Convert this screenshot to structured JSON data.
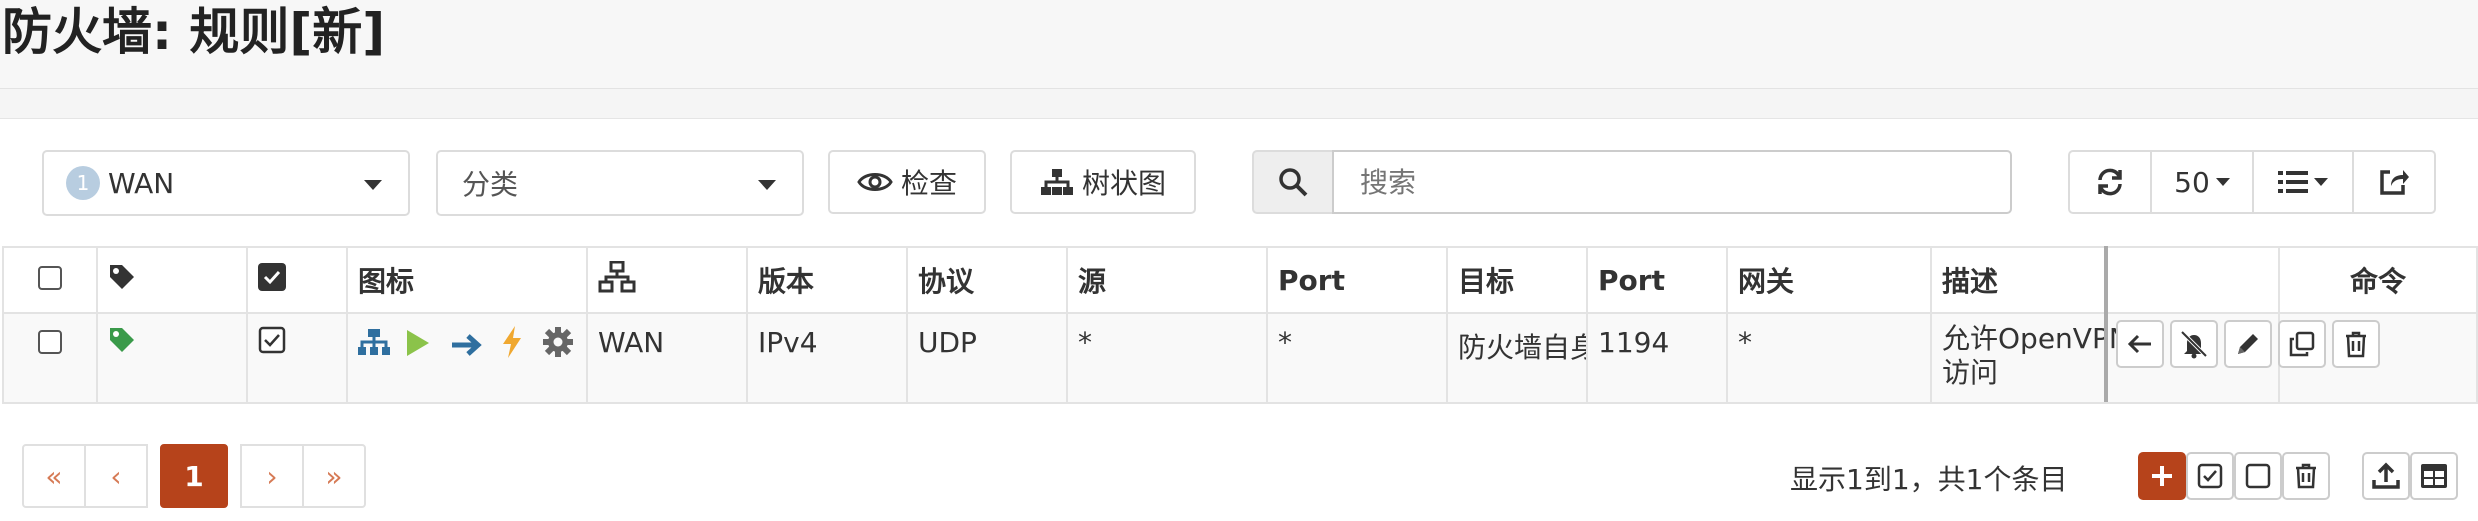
{
  "page": {
    "title": "防火墙: 规则[新]"
  },
  "toolbar": {
    "interface_badge": "1",
    "interface_value": "WAN",
    "category_placeholder": "分类",
    "inspect_label": "检查",
    "tree_label": "树状图",
    "search_placeholder": "搜索",
    "page_size": "50"
  },
  "table": {
    "headers": {
      "icons": "图标",
      "version": "版本",
      "protocol": "协议",
      "source": "源",
      "source_port": "Port",
      "destination": "目标",
      "dest_port": "Port",
      "gateway": "网关",
      "description": "描述",
      "commands": "命令"
    },
    "rows": [
      {
        "interface": "WAN",
        "version": "IPv4",
        "protocol": "UDP",
        "source": "*",
        "source_port": "*",
        "destination": "防火墙自身",
        "dest_port": "1194",
        "gateway": "*",
        "description_line1": "允许OpenVPN",
        "description_line2": "访问"
      }
    ]
  },
  "pagination": {
    "first": "«",
    "prev": "‹",
    "current": "1",
    "next": "›",
    "last": "»",
    "summary": "显示1到1，共1个条目"
  },
  "colors": {
    "accent": "#b6431b",
    "tag_green": "#3a9a4a",
    "icon_blue": "#2f6f9f",
    "play_green": "#8bc34a",
    "bolt_yellow": "#f0a830"
  },
  "icons": {
    "row_status": [
      "network-icon",
      "play-icon",
      "arrow-right-icon",
      "bolt-icon",
      "gear-icon"
    ],
    "commands": [
      "arrow-left-icon",
      "bell-slash-icon",
      "pencil-icon",
      "copy-icon",
      "trash-icon"
    ]
  }
}
